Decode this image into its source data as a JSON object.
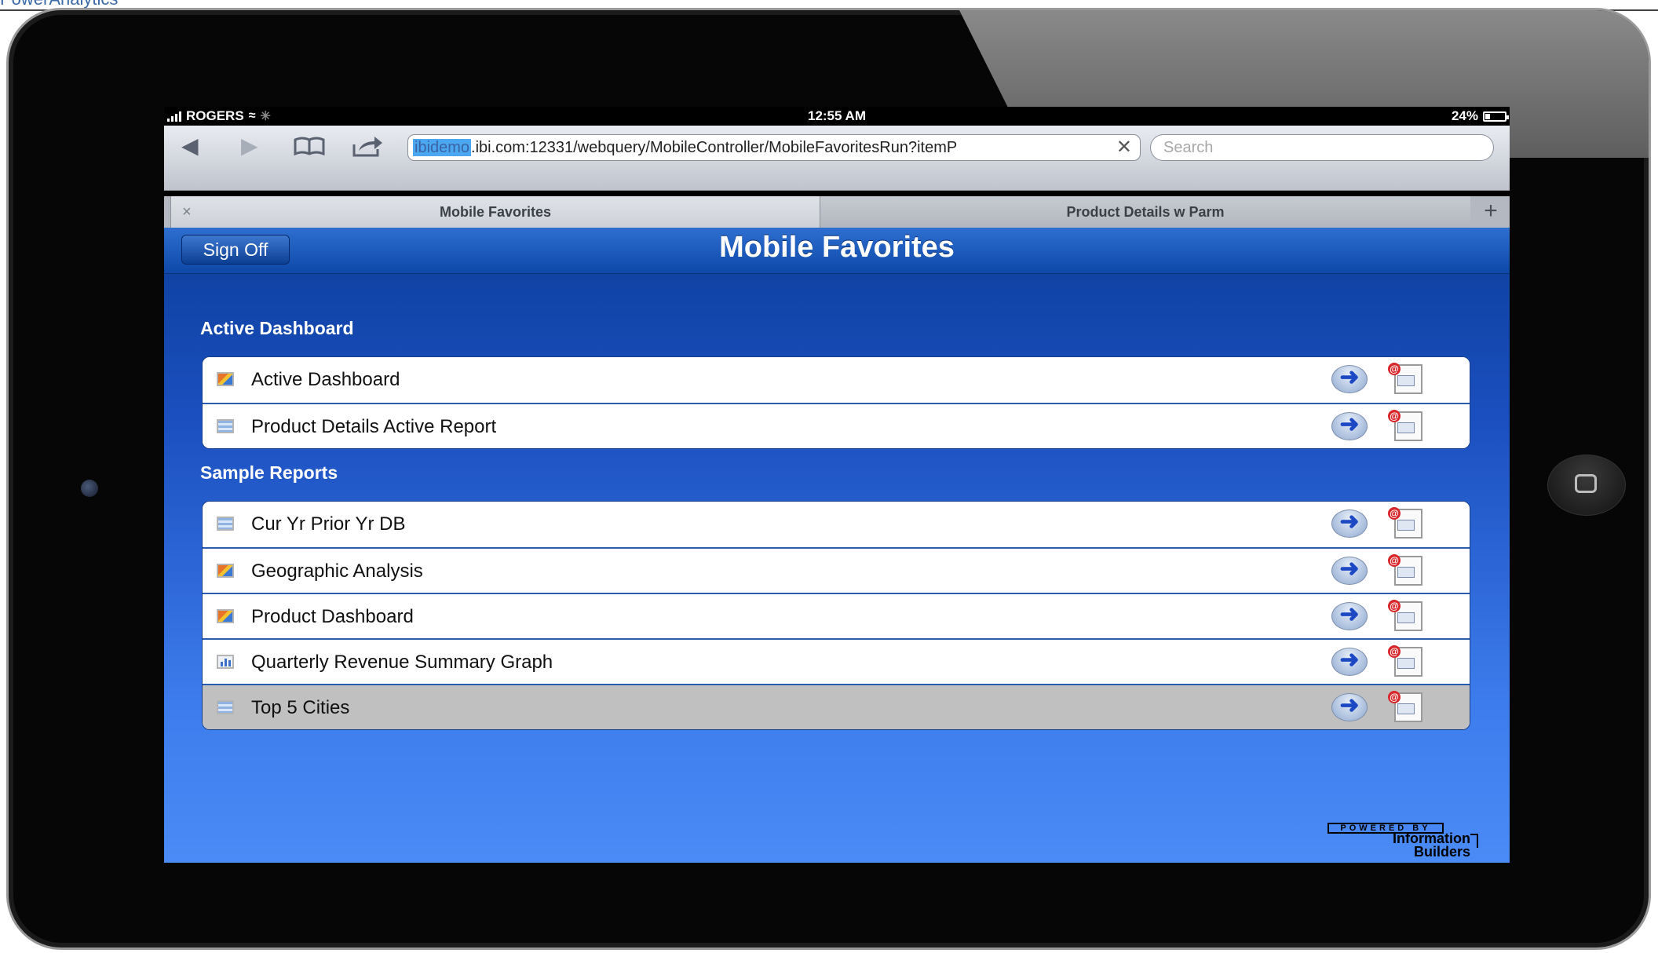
{
  "page_fragment": "PowerAnalytics",
  "status_bar": {
    "carrier": "ROGERS",
    "time": "12:55 AM",
    "battery": "24%"
  },
  "browser": {
    "url_selected": "ibidemo",
    "url_rest": ".ibi.com:12331/webquery/MobileController/MobileFavoritesRun?itemP",
    "search_placeholder": "Search",
    "tabs": [
      {
        "label": "Mobile Favorites",
        "active": true
      },
      {
        "label": "Product Details w Parm",
        "active": false
      }
    ],
    "new_tab_glyph": "+",
    "tab_close_glyph": "×"
  },
  "app": {
    "title": "Mobile Favorites",
    "sign_off_label": "Sign Off",
    "sections": [
      {
        "title": "Active Dashboard",
        "items": [
          {
            "label": "Active Dashboard",
            "icon": "dashboard-icon"
          },
          {
            "label": "Product Details Active Report",
            "icon": "report-icon"
          }
        ]
      },
      {
        "title": "Sample Reports",
        "items": [
          {
            "label": "Cur Yr Prior Yr DB",
            "icon": "report-icon"
          },
          {
            "label": "Geographic Analysis",
            "icon": "dashboard-icon"
          },
          {
            "label": "Product Dashboard",
            "icon": "dashboard-icon"
          },
          {
            "label": "Quarterly Revenue Summary Graph",
            "icon": "graph-icon"
          },
          {
            "label": "Top 5 Cities",
            "icon": "report-icon",
            "selected": true
          }
        ]
      }
    ],
    "footer_logo": {
      "powered": "POWERED BY",
      "line1": "Information",
      "line2": "Builders"
    }
  },
  "colors": {
    "app_top": "#0c3f9b",
    "app_bottom": "#4a8bf6",
    "selected_row": "#c0c0c0"
  }
}
